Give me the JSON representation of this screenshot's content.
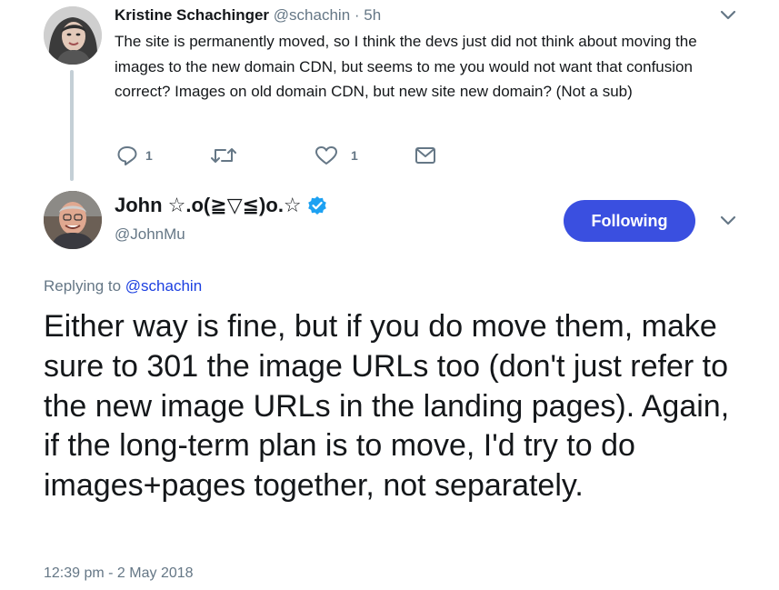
{
  "parent_tweet": {
    "author_name": "Kristine Schachinger",
    "author_handle": "@schachin",
    "separator": "·",
    "time_ago": "5h",
    "text": "The site is permanently moved, so I think the devs just did not think about moving the images to the new domain CDN, but seems to me you would not want that confusion correct? Images on old domain CDN, but new site new domain? (Not a sub)",
    "actions": {
      "reply_count": "1",
      "retweet_count": "",
      "like_count": "1"
    }
  },
  "main_tweet": {
    "author_name": "John ☆.o(≧▽≦)o.☆",
    "author_handle": "@JohnMu",
    "follow_label": "Following",
    "replying_prefix": "Replying to",
    "replying_to": "@schachin",
    "text": "Either way is fine, but if you do move them, make sure to 301 the image URLs too (don't just refer to the new image URLs in the landing pages). Again, if the long-term plan is to move, I'd try to do images+pages together, not separately.",
    "timestamp": "12:39 pm - 2 May 2018"
  },
  "colors": {
    "accent": "#3a4fe0",
    "muted": "#657786",
    "text": "#14171a",
    "thread_line": "#c4cfd6",
    "verified": "#1da1f2"
  },
  "icons": {
    "reply": "reply-icon",
    "retweet": "retweet-icon",
    "like": "heart-icon",
    "dm": "envelope-icon",
    "menu": "chevron-down-icon",
    "verified": "verified-badge-icon"
  }
}
